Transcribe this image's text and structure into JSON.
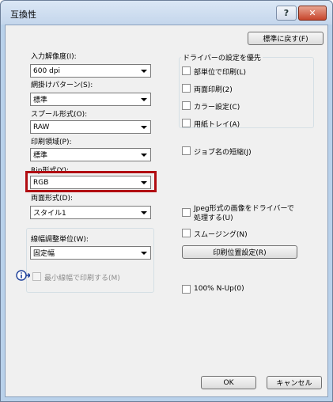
{
  "window": {
    "title": "互換性",
    "help_label": "?",
    "close_label": "✕"
  },
  "top": {
    "reset_button": "標準に戻す(F)"
  },
  "left": {
    "input_resolution": {
      "label": "入力解像度(I):",
      "value": "600 dpi"
    },
    "halftone": {
      "label": "網掛けパターン(S):",
      "value": "標準"
    },
    "spool": {
      "label": "スプール形式(O):",
      "value": "RAW"
    },
    "print_area": {
      "label": "印刷領域(P):",
      "value": "標準"
    },
    "rip_format": {
      "label": "Rip形式(Y):",
      "value": "RGB"
    },
    "duplex_format": {
      "label": "両面形式(D):",
      "value": "スタイル1"
    },
    "line_width_group": {
      "label": "線幅調整単位(W):",
      "value": "固定幅",
      "min_width_checkbox": "最小線幅で印刷する(M)"
    }
  },
  "right": {
    "driver_priority_group": {
      "title": "ドライバーの設定を優先",
      "items": [
        "部単位で印刷(L)",
        "両面印刷(2)",
        "カラー設定(C)",
        "用紙トレイ(A)"
      ]
    },
    "shorten_job_name": "ジョブ名の短縮(J)",
    "jpeg_driver": "Jpeg形式の画像をドライバーで処理する(U)",
    "jpeg_driver_line1": "Jpeg形式の画像をドライバーで",
    "jpeg_driver_line2": "処理する(U)",
    "smoothing": "スムージング(N)",
    "print_position_button": "印刷位置設定(R)",
    "nup_100": "100% N-Up(0)"
  },
  "footer": {
    "ok_label": "OK",
    "cancel_label": "キャンセル"
  },
  "icons": {
    "info": "info-icon"
  },
  "colors": {
    "highlight": "#b10d12",
    "titlebar": "#c4d6ec"
  }
}
